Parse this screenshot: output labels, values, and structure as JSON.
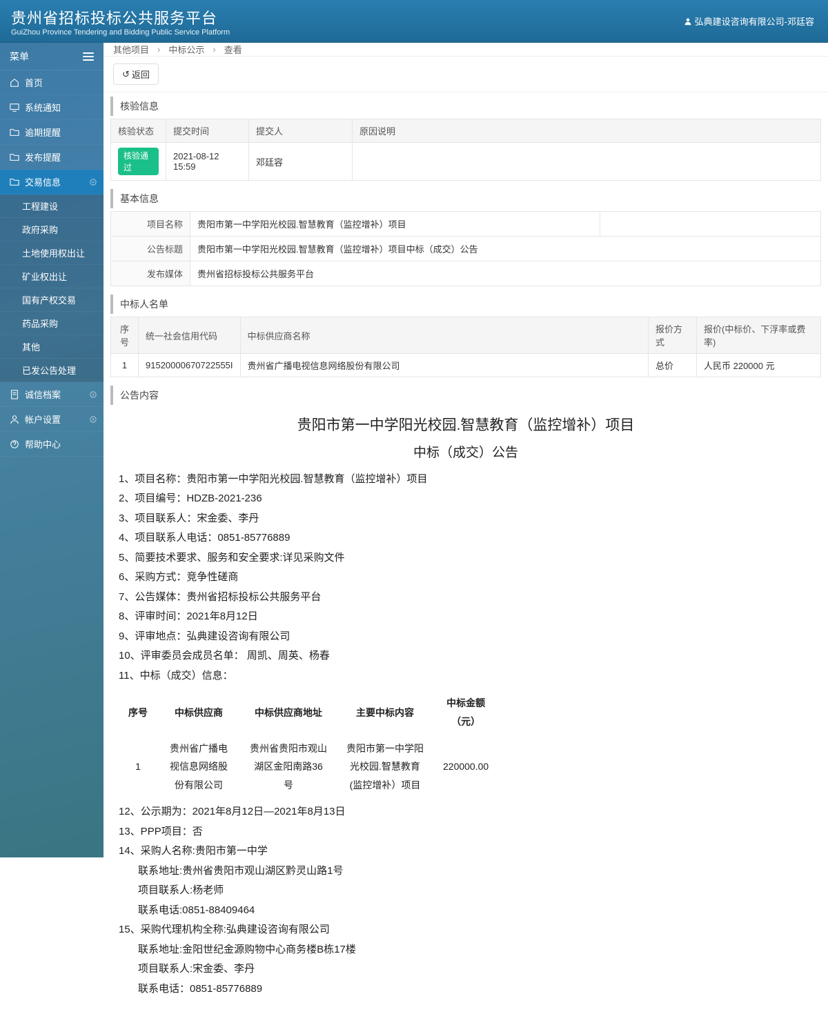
{
  "header": {
    "title": "贵州省招标投标公共服务平台",
    "subtitle": "GuiZhou Province Tendering and Bidding Public Service Platform",
    "user": "弘典建设咨询有限公司-邓廷容"
  },
  "sidebar": {
    "menu_label": "菜单",
    "items": [
      {
        "label": "首页"
      },
      {
        "label": "系统通知"
      },
      {
        "label": "逾期提醒"
      },
      {
        "label": "发布提醒"
      },
      {
        "label": "交易信息",
        "active": true,
        "children": [
          "工程建设",
          "政府采购",
          "土地使用权出让",
          "矿业权出让",
          "国有产权交易",
          "药品采购",
          "其他",
          "已发公告处理"
        ]
      },
      {
        "label": "诚信档案"
      },
      {
        "label": "帐户设置"
      },
      {
        "label": "帮助中心"
      }
    ]
  },
  "breadcrumb": [
    "其他项目",
    "中标公示",
    "查看"
  ],
  "back_label": "返回",
  "verify": {
    "title": "核验信息",
    "headers": [
      "核验状态",
      "提交时间",
      "提交人",
      "原因说明"
    ],
    "row": {
      "status_badge": "核验通过",
      "submit_time": "2021-08-12 15:59",
      "submitter": "邓廷容",
      "reason": ""
    }
  },
  "basic": {
    "title": "基本信息",
    "rows": [
      {
        "k": "项目名称",
        "v": "贵阳市第一中学阳光校园.智慧教育（监控增补）项目"
      },
      {
        "k": "公告标题",
        "v": "贵阳市第一中学阳光校园.智慧教育（监控增补）项目中标（成交）公告"
      },
      {
        "k": "发布媒体",
        "v": "贵州省招标投标公共服务平台"
      }
    ]
  },
  "winners": {
    "title": "中标人名单",
    "headers": [
      "序号",
      "统一社会信用代码",
      "中标供应商名称",
      "报价方式",
      "报价(中标价、下浮率或费率)"
    ],
    "rows": [
      {
        "idx": "1",
        "code": "91520000670722555I",
        "name": "贵州省广播电视信息网络股份有限公司",
        "method": "总价",
        "price": "人民币 220000 元"
      }
    ]
  },
  "notice": {
    "title": "公告内容",
    "doc_title": "贵阳市第一中学阳光校园.智慧教育（监控增补）项目",
    "doc_subtitle": "中标（成交）公告",
    "lines": [
      "1、项目名称：贵阳市第一中学阳光校园.智慧教育（监控增补）项目",
      "2、项目编号：HDZB-2021-236",
      "3、项目联系人：宋金委、李丹",
      "4、项目联系人电话：0851-85776889",
      "5、简要技术要求、服务和安全要求:详见采购文件",
      "6、采购方式：竞争性磋商",
      "7、公告媒体：贵州省招标投标公共服务平台",
      "8、评审时间：2021年8月12日",
      "9、评审地点：弘典建设咨询有限公司",
      "10、评审委员会成员名单：   周凯、周英、杨春",
      "11、中标（成交）信息："
    ],
    "detail": {
      "headers": [
        "序号",
        "中标供应商",
        "中标供应商地址",
        "主要中标内容",
        "中标金额（元）"
      ],
      "row": {
        "idx": "1",
        "supplier": "贵州省广播电视信息网络股份有限公司",
        "addr": "贵州省贵阳市观山湖区金阳南路36号",
        "content": "贵阳市第一中学阳光校园.智慧教育(监控增补）项目",
        "amount": "220000.00"
      }
    },
    "lines2": [
      "12、公示期为：2021年8月12日—2021年8月13日",
      "13、PPP项目：否",
      "14、采购人名称:贵阳市第一中学"
    ],
    "lines2_indent": [
      "联系地址:贵州省贵阳市观山湖区黔灵山路1号",
      "项目联系人:杨老师",
      "联系电话:0851-88409464"
    ],
    "line15": "15、采购代理机构全称:弘典建设咨询有限公司",
    "line15_indent": [
      "联系地址:金阳世纪金源购物中心商务楼B栋17楼",
      "项目联系人:宋金委、李丹",
      "联系电话：0851-85776889"
    ]
  }
}
